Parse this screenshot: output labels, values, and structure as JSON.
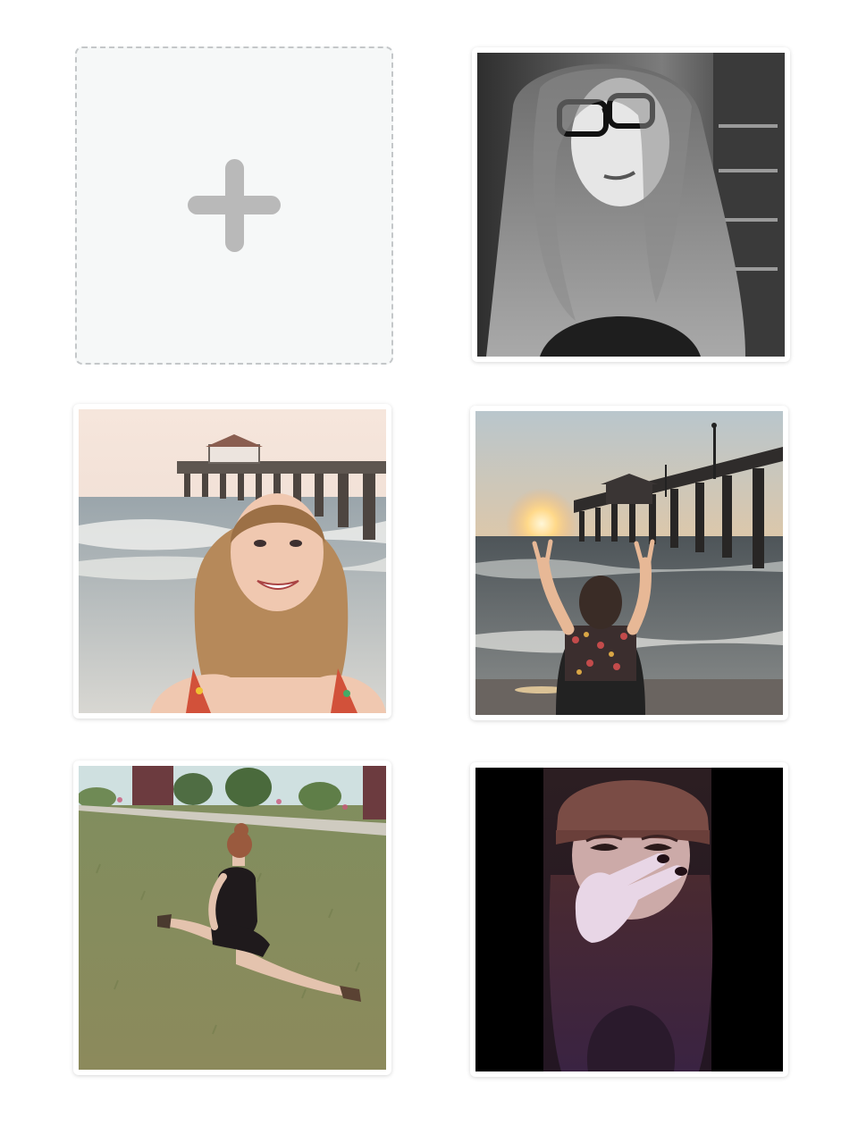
{
  "gallery": {
    "add_button": {
      "icon": "plus-icon",
      "color": "#b9b9b9"
    },
    "photos": [
      {
        "id": "photo-1",
        "tone": "black-and-white",
        "subject": "selfie-with-glasses"
      },
      {
        "id": "photo-2",
        "tone": "color",
        "subject": "smiling-at-beach-pier"
      },
      {
        "id": "photo-3",
        "tone": "color",
        "subject": "sunset-pier-peace-signs"
      },
      {
        "id": "photo-4",
        "tone": "faded-color",
        "subject": "splits-on-grass"
      },
      {
        "id": "photo-5",
        "tone": "purple-tint",
        "subject": "beanie-selfie"
      }
    ]
  }
}
